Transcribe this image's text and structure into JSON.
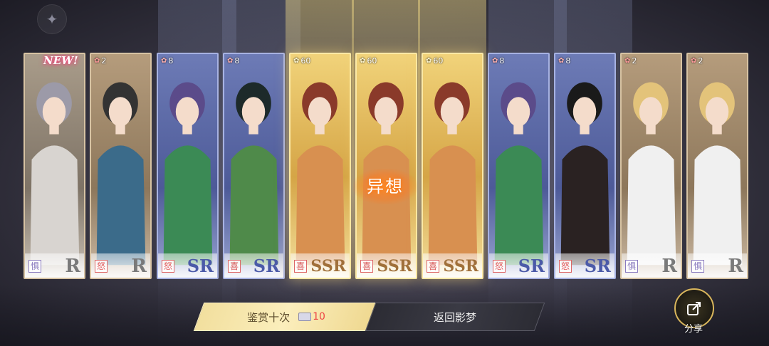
{
  "cards": [
    {
      "count": "",
      "emotion": "惧",
      "emotion_type": "fear",
      "rarity": "R",
      "new": true
    },
    {
      "count": "2",
      "emotion": "怒",
      "emotion_type": "anger",
      "rarity": "R",
      "new": false
    },
    {
      "count": "8",
      "emotion": "怒",
      "emotion_type": "anger",
      "rarity": "SR",
      "new": false
    },
    {
      "count": "8",
      "emotion": "喜",
      "emotion_type": "joy",
      "rarity": "SR",
      "new": false
    },
    {
      "count": "60",
      "emotion": "喜",
      "emotion_type": "joy",
      "rarity": "SSR",
      "new": false
    },
    {
      "count": "60",
      "emotion": "喜",
      "emotion_type": "joy",
      "rarity": "SSR",
      "new": false
    },
    {
      "count": "60",
      "emotion": "喜",
      "emotion_type": "joy",
      "rarity": "SSR",
      "new": false
    },
    {
      "count": "8",
      "emotion": "怒",
      "emotion_type": "anger",
      "rarity": "SR",
      "new": false
    },
    {
      "count": "8",
      "emotion": "怒",
      "emotion_type": "anger",
      "rarity": "SR",
      "new": false
    },
    {
      "count": "2",
      "emotion": "惧",
      "emotion_type": "fear",
      "rarity": "R",
      "new": false
    },
    {
      "count": "2",
      "emotion": "惧",
      "emotion_type": "fear",
      "rarity": "R",
      "new": false
    }
  ],
  "new_label": "NEW!",
  "yixiang_label": "异想",
  "buttons": {
    "appreciate_ten": "鉴赏十次",
    "ticket_cost": "10",
    "return": "返回影梦",
    "share": "分享"
  },
  "colors": {
    "ssr_gold": "#f1d37a",
    "sr_blue": "#6d7bb6",
    "r_tan": "#b59c7c",
    "accent_red": "#e44444"
  }
}
